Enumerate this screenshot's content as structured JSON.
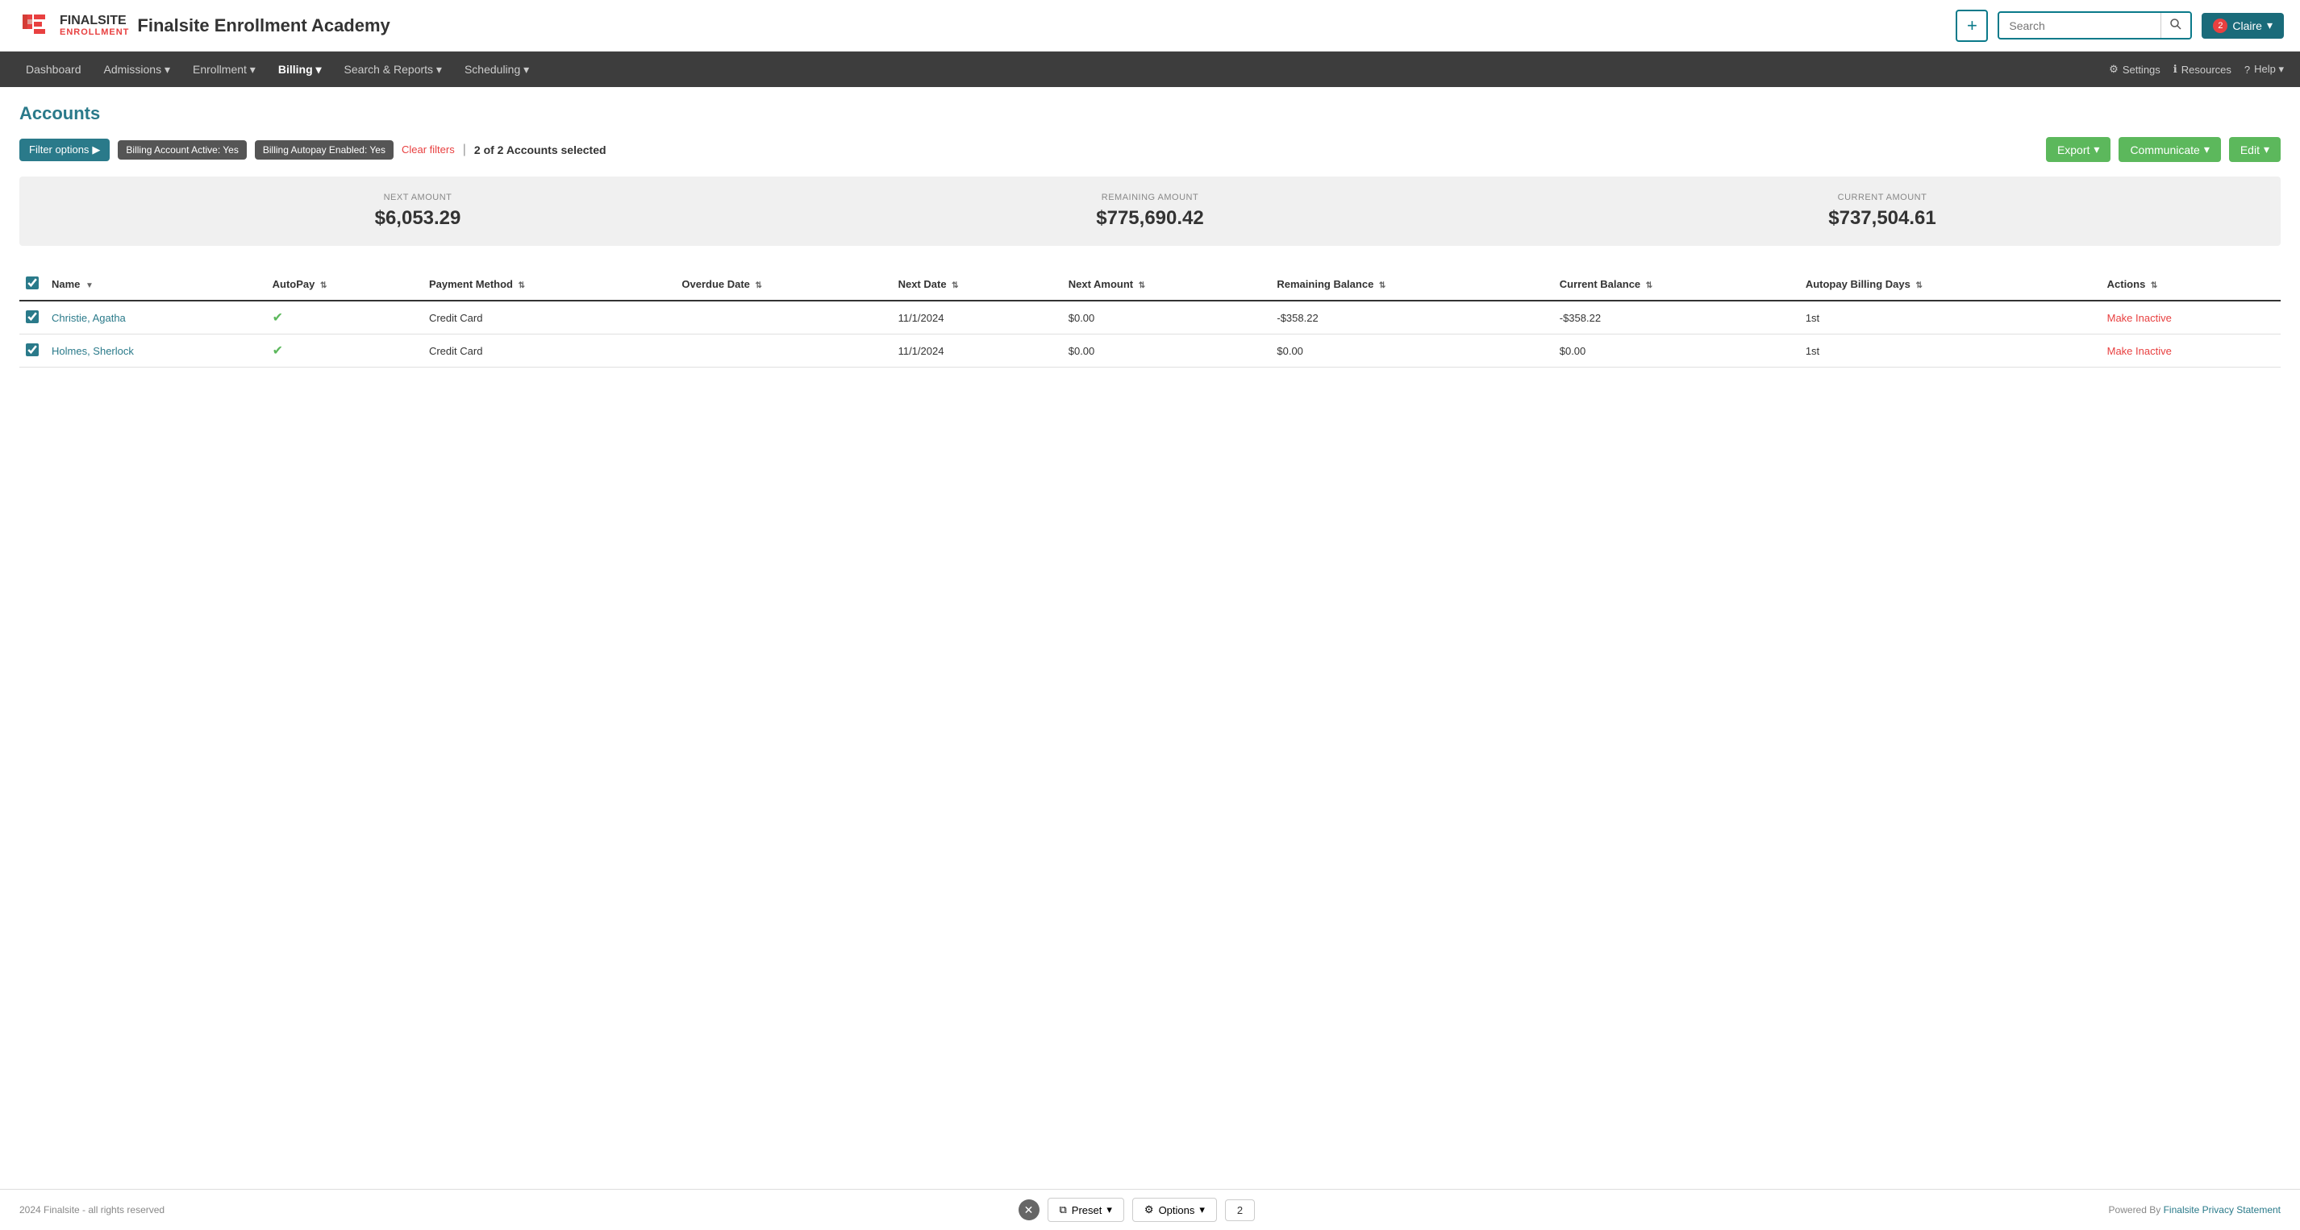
{
  "header": {
    "brand_name": "FINALSITE",
    "brand_sub": "ENROLLMENT",
    "site_title": "Finalsite Enrollment Academy",
    "plus_label": "+",
    "search_placeholder": "Search",
    "notification_count": "2",
    "user_name": "Claire",
    "chevron": "▾"
  },
  "nav": {
    "items": [
      {
        "label": "Dashboard",
        "active": false
      },
      {
        "label": "Admissions",
        "active": false,
        "has_dropdown": true
      },
      {
        "label": "Enrollment",
        "active": false,
        "has_dropdown": true
      },
      {
        "label": "Billing",
        "active": true,
        "has_dropdown": true
      },
      {
        "label": "Search & Reports",
        "active": false,
        "has_dropdown": true
      },
      {
        "label": "Scheduling",
        "active": false,
        "has_dropdown": true
      }
    ],
    "right_items": [
      {
        "icon": "gear",
        "label": "Settings"
      },
      {
        "icon": "info",
        "label": "Resources"
      },
      {
        "icon": "help",
        "label": "Help",
        "has_dropdown": true
      }
    ]
  },
  "page": {
    "title": "Accounts",
    "filter_options_label": "Filter options",
    "filter_tags": [
      "Billing Account Active: Yes",
      "Billing Autopay Enabled: Yes"
    ],
    "clear_filters_label": "Clear filters",
    "selected_text": "2 of 2 Accounts selected",
    "export_label": "Export",
    "communicate_label": "Communicate",
    "edit_label": "Edit"
  },
  "summary": {
    "next_amount_label": "NEXT AMOUNT",
    "next_amount_value": "$6,053.29",
    "remaining_amount_label": "REMAINING AMOUNT",
    "remaining_amount_value": "$775,690.42",
    "current_amount_label": "CURRENT AMOUNT",
    "current_amount_value": "$737,504.61"
  },
  "table": {
    "columns": [
      {
        "key": "name",
        "label": "Name",
        "sortable": true
      },
      {
        "key": "autopay",
        "label": "AutoPay",
        "sortable": true
      },
      {
        "key": "payment_method",
        "label": "Payment Method",
        "sortable": true
      },
      {
        "key": "overdue_date",
        "label": "Overdue Date",
        "sortable": true
      },
      {
        "key": "next_date",
        "label": "Next Date",
        "sortable": true
      },
      {
        "key": "next_amount",
        "label": "Next Amount",
        "sortable": true
      },
      {
        "key": "remaining_balance",
        "label": "Remaining Balance",
        "sortable": true
      },
      {
        "key": "current_balance",
        "label": "Current Balance",
        "sortable": true
      },
      {
        "key": "autopay_billing_days",
        "label": "Autopay Billing Days",
        "sortable": true
      },
      {
        "key": "actions",
        "label": "Actions",
        "sortable": true
      }
    ],
    "rows": [
      {
        "checked": true,
        "name": "Christie, Agatha",
        "autopay": true,
        "payment_method": "Credit Card",
        "overdue_date": "",
        "next_date": "11/1/2024",
        "next_amount": "$0.00",
        "remaining_balance": "-$358.22",
        "current_balance": "-$358.22",
        "autopay_billing_days": "1st",
        "action_label": "Make Inactive"
      },
      {
        "checked": true,
        "name": "Holmes, Sherlock",
        "autopay": true,
        "payment_method": "Credit Card",
        "overdue_date": "",
        "next_date": "11/1/2024",
        "next_amount": "$0.00",
        "remaining_balance": "$0.00",
        "current_balance": "$0.00",
        "autopay_billing_days": "1st",
        "action_label": "Make Inactive"
      }
    ]
  },
  "footer": {
    "copyright": "2024 Finalsite - all rights reserved",
    "powered_by": "Powered By",
    "finalsite_link": "Finalsite",
    "privacy_link": "Privacy Statement",
    "preset_label": "Preset",
    "options_label": "Options",
    "count": "2"
  }
}
